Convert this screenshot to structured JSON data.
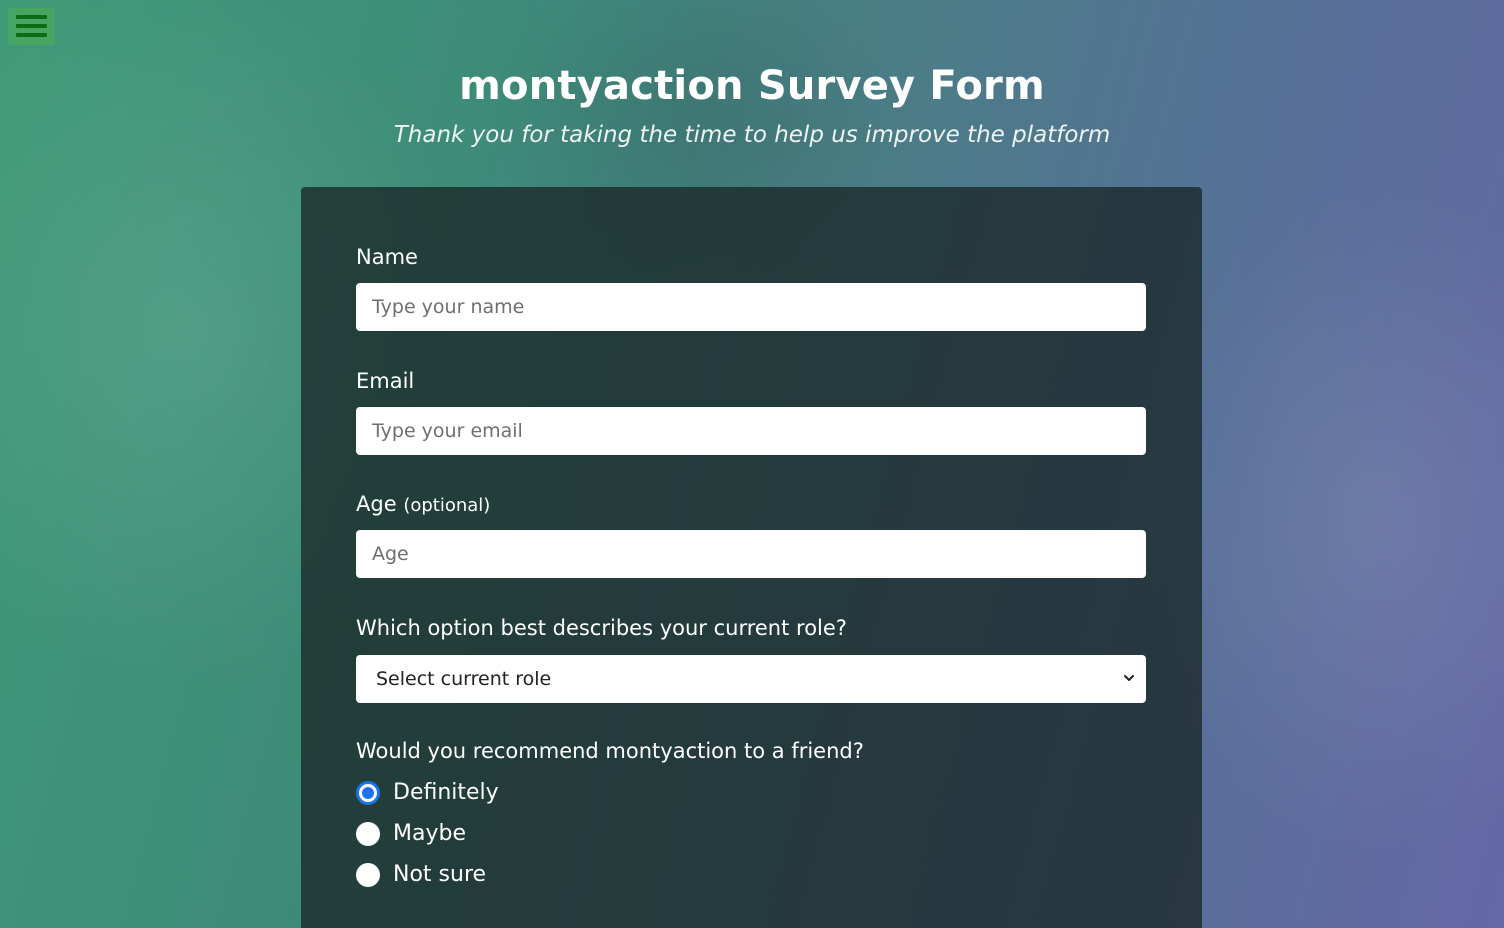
{
  "nav": {
    "menu_icon": "hamburger-menu-icon"
  },
  "header": {
    "title": "montyaction Survey Form",
    "subtitle": "Thank you for taking the time to help us improve the platform"
  },
  "form": {
    "name": {
      "label": "Name",
      "placeholder": "Type your name",
      "value": ""
    },
    "email": {
      "label": "Email",
      "placeholder": "Type your email",
      "value": ""
    },
    "age": {
      "label": "Age",
      "label_note": "(optional)",
      "placeholder": "Age",
      "value": ""
    },
    "role": {
      "label": "Which option best describes your current role?",
      "selected": "Select current role",
      "icon": "chevron-down-icon"
    },
    "recommend": {
      "label": "Would you recommend montyaction to a friend?",
      "options": [
        {
          "label": "Definitely",
          "checked": true
        },
        {
          "label": "Maybe",
          "checked": false
        },
        {
          "label": "Not sure",
          "checked": false
        }
      ]
    }
  },
  "colors": {
    "radio_accent": "#1a73e8",
    "menu_bars": "#0d6b14",
    "card_background": "rgba(25,40,40,0.78)"
  }
}
